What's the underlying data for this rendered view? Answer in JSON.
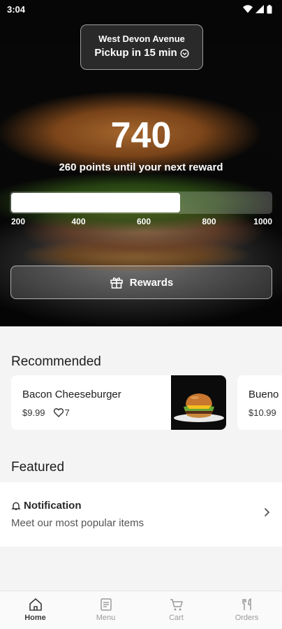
{
  "status_bar": {
    "time": "3:04"
  },
  "location": {
    "name": "West Devon Avenue",
    "pickup": "Pickup in 15 min"
  },
  "rewards": {
    "points": "740",
    "subtitle": "260 points until your next reward",
    "progress_fraction": 0.65,
    "ticks": [
      "200",
      "400",
      "600",
      "800",
      "1000"
    ],
    "button_label": "Rewards"
  },
  "recommended": {
    "title": "Recommended",
    "items": [
      {
        "name": "Bacon Cheeseburger",
        "price": "$9.99",
        "likes": "7"
      },
      {
        "name": "Bueno",
        "price": "$10.99"
      }
    ]
  },
  "featured": {
    "title": "Featured",
    "items": [
      {
        "title": "Notification",
        "subtitle": "Meet our most popular items"
      }
    ]
  },
  "nav": {
    "items": [
      {
        "label": "Home",
        "icon": "home-icon",
        "active": true
      },
      {
        "label": "Menu",
        "icon": "menu-icon",
        "active": false
      },
      {
        "label": "Cart",
        "icon": "cart-icon",
        "active": false
      },
      {
        "label": "Orders",
        "icon": "orders-icon",
        "active": false
      }
    ]
  },
  "colors": {
    "background": "#f4f4f4",
    "hero_dark": "#090909",
    "text": "#1d1d1d",
    "nav_inactive": "#9a9a9a",
    "nav_active": "#3c3c3c"
  }
}
